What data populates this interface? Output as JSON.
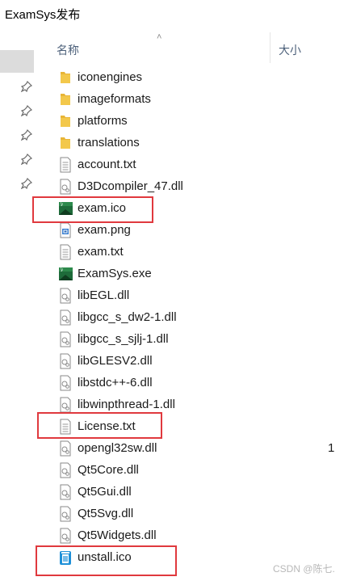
{
  "window": {
    "title": "ExamSys发布"
  },
  "header": {
    "name_col": "名称",
    "size_col": "大小"
  },
  "files": [
    {
      "name": "iconengines",
      "type": "folder"
    },
    {
      "name": "imageformats",
      "type": "folder"
    },
    {
      "name": "platforms",
      "type": "folder"
    },
    {
      "name": "translations",
      "type": "folder"
    },
    {
      "name": "account.txt",
      "type": "txt"
    },
    {
      "name": "D3Dcompiler_47.dll",
      "type": "dll"
    },
    {
      "name": "exam.ico",
      "type": "examico"
    },
    {
      "name": "exam.png",
      "type": "png"
    },
    {
      "name": "exam.txt",
      "type": "txt"
    },
    {
      "name": "ExamSys.exe",
      "type": "examico"
    },
    {
      "name": "libEGL.dll",
      "type": "dll"
    },
    {
      "name": "libgcc_s_dw2-1.dll",
      "type": "dll"
    },
    {
      "name": "libgcc_s_sjlj-1.dll",
      "type": "dll"
    },
    {
      "name": "libGLESV2.dll",
      "type": "dll"
    },
    {
      "name": "libstdc++-6.dll",
      "type": "dll"
    },
    {
      "name": "libwinpthread-1.dll",
      "type": "dll"
    },
    {
      "name": "License.txt",
      "type": "txt"
    },
    {
      "name": "opengl32sw.dll",
      "type": "dll",
      "size": "1"
    },
    {
      "name": "Qt5Core.dll",
      "type": "dll"
    },
    {
      "name": "Qt5Gui.dll",
      "type": "dll"
    },
    {
      "name": "Qt5Svg.dll",
      "type": "dll"
    },
    {
      "name": "Qt5Widgets.dll",
      "type": "dll"
    },
    {
      "name": "unstall.ico",
      "type": "trash"
    }
  ],
  "watermark": "CSDN @陈七.",
  "colors": {
    "highlight": "#e0393e",
    "folder": "#e8b537",
    "header_text": "#4c607a"
  }
}
